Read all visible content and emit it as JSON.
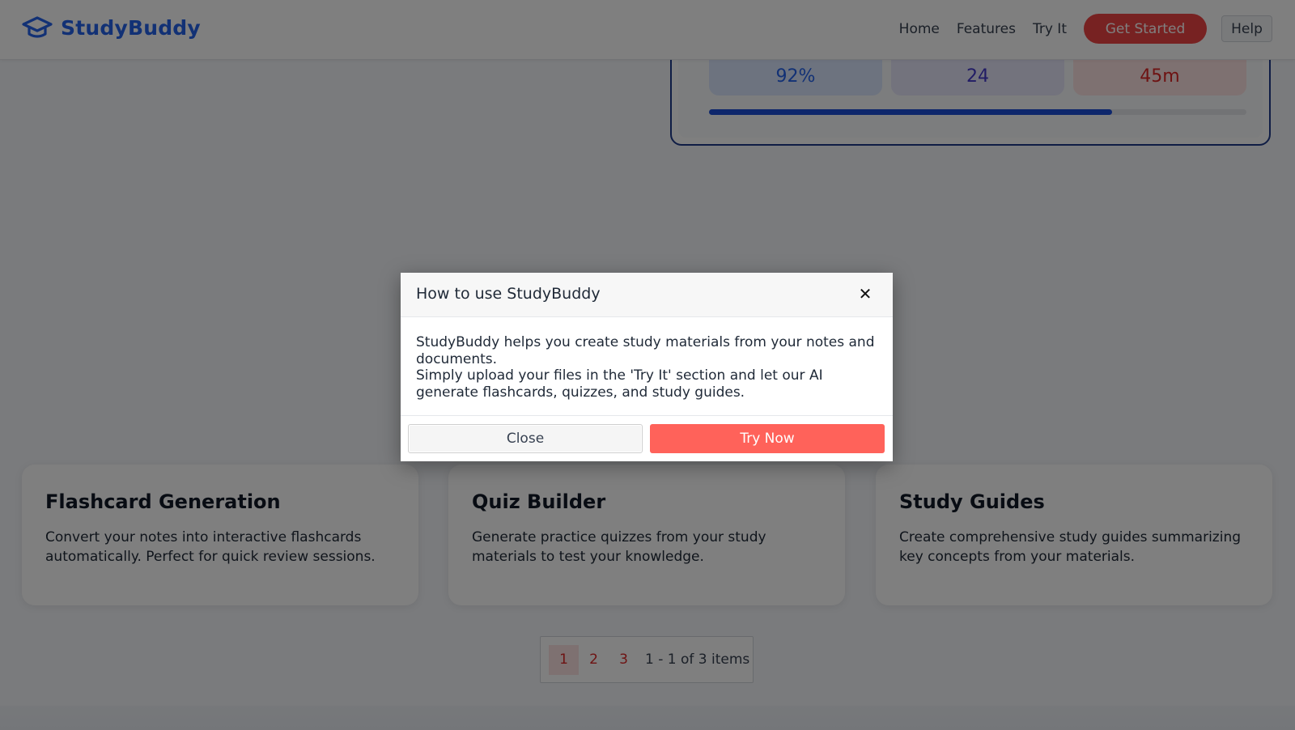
{
  "header": {
    "brand": "StudyBuddy",
    "nav": [
      "Home",
      "Features",
      "Try It"
    ],
    "get_started": "Get Started",
    "help": "Help"
  },
  "stats": {
    "accuracy": "92%",
    "cards": "24",
    "time": "45m",
    "progress_fraction": 0.75
  },
  "features": [
    {
      "title": "Flashcard Generation",
      "text": "Convert your notes into interactive flashcards automatically. Perfect for quick review sessions."
    },
    {
      "title": "Quiz Builder",
      "text": "Generate practice quizzes from your study materials to test your knowledge."
    },
    {
      "title": "Study Guides",
      "text": "Create comprehensive study guides summarizing key concepts from your materials."
    }
  ],
  "pagination": {
    "pages": [
      "1",
      "2",
      "3"
    ],
    "active": "1",
    "info": "1 - 1 of 3 items"
  },
  "modal": {
    "title": "How to use StudyBuddy",
    "close_icon": "close-icon",
    "body_line1": "StudyBuddy helps you create study materials from your notes and documents.",
    "body_line2": "Simply upload your files in the 'Try It' section and let our AI generate flashcards, quizzes, and study guides.",
    "close_label": "Close",
    "try_label": "Try Now"
  },
  "colors": {
    "brand": "#2563eb",
    "accent": "#ef4444",
    "try_button": "#ff625a"
  }
}
